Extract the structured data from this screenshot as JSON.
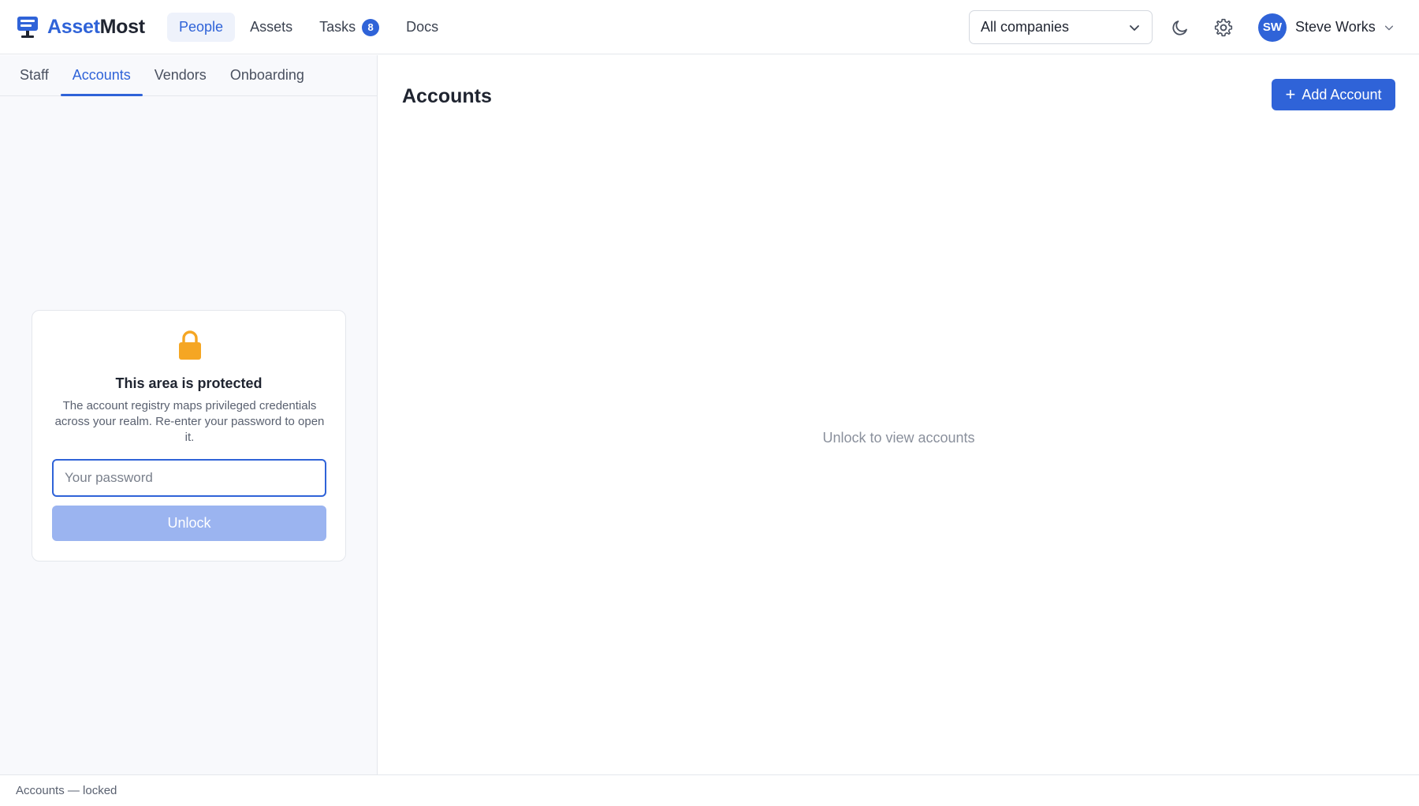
{
  "app": {
    "logo_a": "Asset",
    "logo_b": "Most"
  },
  "nav": {
    "items": [
      {
        "label": "People",
        "active": true
      },
      {
        "label": "Assets"
      },
      {
        "label": "Tasks",
        "badge": "8"
      },
      {
        "label": "Docs"
      }
    ]
  },
  "company_select": {
    "value": "All companies"
  },
  "user": {
    "initials": "SW",
    "name": "Steve Works"
  },
  "subtabs": [
    {
      "label": "Staff"
    },
    {
      "label": "Accounts",
      "active": true
    },
    {
      "label": "Vendors"
    },
    {
      "label": "Onboarding"
    }
  ],
  "lock_card": {
    "title": "This area is protected",
    "description": "The account registry maps privileged credentials across your realm. Re-enter your password to open it.",
    "password_placeholder": "Your password",
    "unlock_label": "Unlock"
  },
  "main": {
    "title": "Accounts",
    "add_label": "Add Account",
    "empty_text": "Unlock to view accounts"
  },
  "statusbar": {
    "text": "Accounts — locked"
  },
  "colors": {
    "accent": "#2f63d8",
    "lock": "#f5a623",
    "unlock_disabled": "#9bb4f0"
  },
  "icons": [
    "monitor-logo-icon",
    "chevron-down-icon",
    "moon-icon",
    "gear-icon",
    "lock-icon",
    "plus-icon"
  ]
}
